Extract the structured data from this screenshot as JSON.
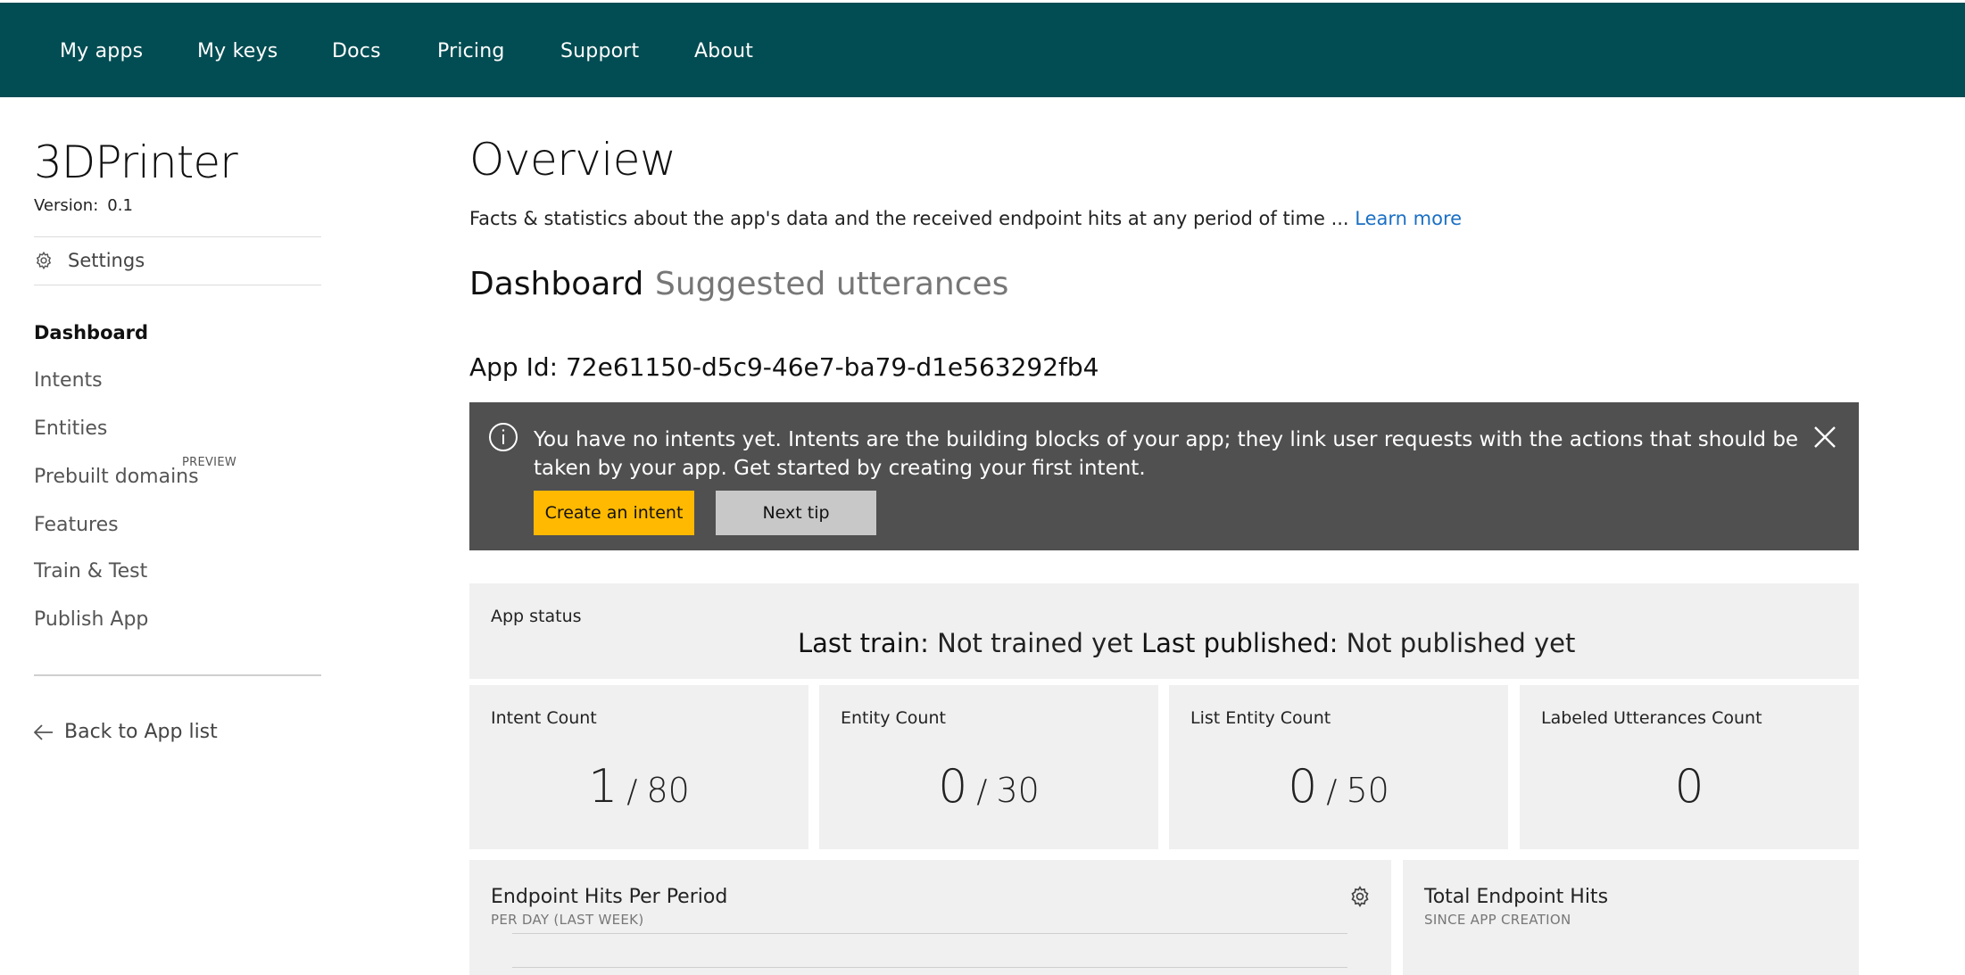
{
  "nav": {
    "items": [
      "My apps",
      "My keys",
      "Docs",
      "Pricing",
      "Support",
      "About"
    ]
  },
  "sidebar": {
    "app_name": "3DPrinter",
    "version_label": "Version:",
    "version_value": "0.1",
    "settings_label": "Settings",
    "items": [
      {
        "label": "Dashboard",
        "active": true
      },
      {
        "label": "Intents"
      },
      {
        "label": "Entities"
      },
      {
        "label": "Prebuilt domains",
        "badge": "PREVIEW"
      },
      {
        "label": "Features"
      },
      {
        "label": "Train & Test"
      },
      {
        "label": "Publish App"
      }
    ],
    "back_label": "Back to App list"
  },
  "main": {
    "title": "Overview",
    "description": "Facts & statistics about the app's data and the received endpoint hits at any period of time ...",
    "learn_more": "Learn more",
    "tabs": [
      {
        "label": "Dashboard",
        "active": true
      },
      {
        "label": "Suggested utterances",
        "active": false
      }
    ],
    "app_id": "App Id: 72e61150-d5c9-46e7-ba79-d1e563292fb4"
  },
  "tip": {
    "text": "You have no intents yet. Intents are the building blocks of your app; they link user requests with the actions that should be taken by your app. Get started by creating your first intent.",
    "create_button": "Create an intent",
    "next_button": "Next tip"
  },
  "status": {
    "label": "App status",
    "last_train_label": "Last train:",
    "last_train_value": "Not trained yet",
    "last_published_label": "Last published:",
    "last_published_value": "Not published yet"
  },
  "counts": [
    {
      "label": "Intent Count",
      "value": "1",
      "max": "80"
    },
    {
      "label": "Entity Count",
      "value": "0",
      "max": "30"
    },
    {
      "label": "List Entity Count",
      "value": "0",
      "max": "50"
    },
    {
      "label": "Labeled Utterances Count",
      "value": "0"
    }
  ],
  "hits": {
    "title": "Endpoint Hits Per Period",
    "subtitle": "PER DAY (LAST WEEK)"
  },
  "total_hits": {
    "title": "Total Endpoint Hits",
    "subtitle": "SINCE APP CREATION"
  },
  "colors": {
    "nav_bg": "#024d53",
    "tip_bg": "#505050",
    "primary_button": "#ffb900",
    "link": "#1a6fc4"
  }
}
